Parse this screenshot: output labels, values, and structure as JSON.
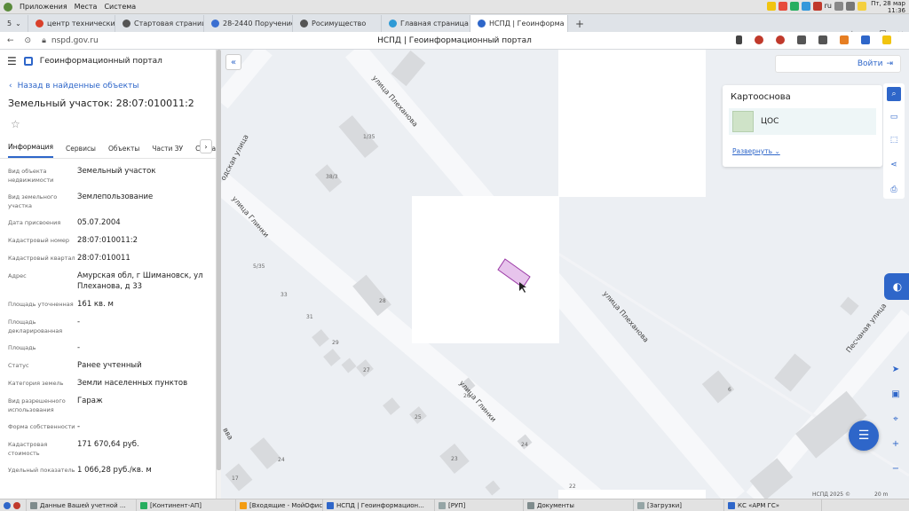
{
  "os": {
    "menu": [
      "Приложения",
      "Места",
      "Система"
    ],
    "lang": "ru",
    "clock_line1": "Пт, 28 мар",
    "clock_line2": "11:36"
  },
  "browser": {
    "tabs": [
      {
        "label": "5",
        "color": "#888888"
      },
      {
        "label": "центр технических, т",
        "color": "#d9402b"
      },
      {
        "label": "Стартовая страница",
        "color": "#555555"
      },
      {
        "label": "28-2440 Поручение",
        "color": "#3b6fd1"
      },
      {
        "label": "Росимущество",
        "color": "#555555"
      },
      {
        "label": "Главная страница",
        "color": "#2e9ad6"
      },
      {
        "label": "НСПД | Геоинформа",
        "color": "#2e66c9"
      }
    ],
    "url": "nspd.gov.ru",
    "page_title": "НСПД | Геоинформационный портал"
  },
  "panel": {
    "portal_name": "Геоинформационный портал",
    "back_label": "Назад в найденные объекты",
    "object_title": "Земельный участок: 28:07:010011:2",
    "tabs": [
      "Информация",
      "Сервисы",
      "Объекты",
      "Части ЗУ",
      "Соста"
    ],
    "tab_arrow": "›",
    "fields": [
      {
        "label": "Вид объекта недвижимости",
        "value": "Земельный участок"
      },
      {
        "label": "Вид земельного участка",
        "value": "Землепользование"
      },
      {
        "label": "Дата присвоения",
        "value": "05.07.2004"
      },
      {
        "label": "Кадастровый номер",
        "value": "28:07:010011:2"
      },
      {
        "label": "Кадастровый квартал",
        "value": "28:07:010011"
      },
      {
        "label": "Адрес",
        "value": "Амурская обл, г Шимановск, ул Плеханова, д 33"
      },
      {
        "label": "Площадь уточненная",
        "value": "161 кв. м"
      },
      {
        "label": "Площадь декларированная",
        "value": "-"
      },
      {
        "label": "Площадь",
        "value": "-"
      },
      {
        "label": "Статус",
        "value": "Ранее учтенный"
      },
      {
        "label": "Категория земель",
        "value": "Земли населенных пунктов"
      },
      {
        "label": "Вид разрешенного использования",
        "value": "Гараж"
      },
      {
        "label": "Форма собственности",
        "value": "-"
      },
      {
        "label": "Кадастровая стоимость",
        "value": "171 670,64 руб."
      },
      {
        "label": "Удельный показатель",
        "value": "1 066,28 руб./кв. м"
      }
    ]
  },
  "map": {
    "login_label": "Войти",
    "basemap_title": "Картооснова",
    "basemap_option": "ЦОС",
    "expand_label": "Развернуть",
    "copyright": "НСПД 2025 ©",
    "scale": "20 m",
    "streets": [
      "улица Плеханова",
      "улица Плеханова",
      "улица Глинки",
      "улица Глинки",
      "одская улица",
      "Песчаная улица",
      "вва"
    ],
    "house_numbers": [
      "1/35",
      "38/3",
      "5/35",
      "33",
      "31",
      "28",
      "29",
      "27",
      "26",
      "25",
      "24",
      "23",
      "24",
      "22",
      "17",
      "6"
    ],
    "parcel_color": "#e7c4ec",
    "accent_color": "#2e66c9"
  },
  "taskbar": [
    "Данные Вашей учетной ...",
    "[Континент-АП]",
    "[Входящие - МойОфис П...",
    "НСПД | Геоинформацион...",
    "[РУП]",
    "Документы",
    "[Загрузки]",
    "КС «АРМ ГС»"
  ]
}
